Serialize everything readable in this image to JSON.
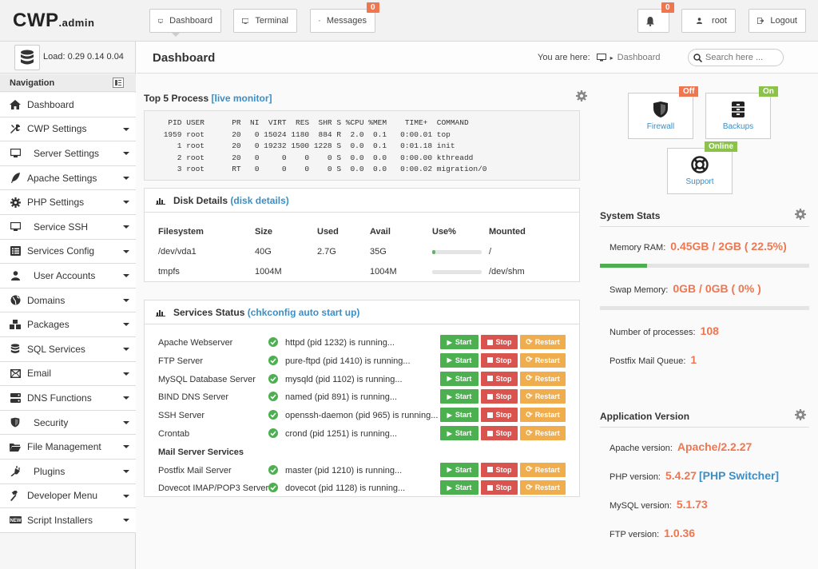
{
  "topbar": {
    "logo_main": "CWP",
    "logo_sub": "admin",
    "dashboard_label": "Dashboard",
    "terminal_label": "Terminal",
    "messages_label": "Messages",
    "messages_count": "0",
    "notifications_count": "0",
    "user_label": "root",
    "logout_label": "Logout"
  },
  "sidebar": {
    "load_label": "Load: 0.29  0.14  0.04",
    "nav_heading": "Navigation",
    "items": [
      {
        "label": "Dashboard",
        "icon": "home-icon"
      },
      {
        "label": "CWP Settings",
        "icon": "tools-icon"
      },
      {
        "label": "Server Settings",
        "icon": "monitor-icon"
      },
      {
        "label": "Apache Settings",
        "icon": "feather-icon"
      },
      {
        "label": "PHP Settings",
        "icon": "gear-icon"
      },
      {
        "label": "Service SSH",
        "icon": "monitor-icon"
      },
      {
        "label": "Services Config",
        "icon": "list-icon"
      },
      {
        "label": "User Accounts",
        "icon": "user-icon"
      },
      {
        "label": "Domains",
        "icon": "globe-icon"
      },
      {
        "label": "Packages",
        "icon": "boxes-icon"
      },
      {
        "label": "SQL Services",
        "icon": "database-icon"
      },
      {
        "label": "Email",
        "icon": "envelope-icon"
      },
      {
        "label": "DNS Functions",
        "icon": "server-icon"
      },
      {
        "label": "Security",
        "icon": "shield-icon"
      },
      {
        "label": "File Management",
        "icon": "folder-icon"
      },
      {
        "label": "Plugins",
        "icon": "plug-icon"
      },
      {
        "label": "Developer Menu",
        "icon": "hammer-icon"
      },
      {
        "label": "Script Installers",
        "icon": "new-icon"
      }
    ]
  },
  "header": {
    "title": "Dashboard",
    "you_are_here": "You are here:",
    "crumb": "Dashboard",
    "search_placeholder": "Search here ..."
  },
  "top_process": {
    "title": "Top 5 Process",
    "link": "[live monitor]",
    "output": "  PID USER      PR  NI  VIRT  RES  SHR S %CPU %MEM    TIME+  COMMAND\n 1959 root      20   0 15024 1180  884 R  2.0  0.1   0:00.01 top\n    1 root      20   0 19232 1500 1228 S  0.0  0.1   0:01.18 init\n    2 root      20   0     0    0    0 S  0.0  0.0   0:00.00 kthreadd\n    3 root      RT   0     0    0    0 S  0.0  0.0   0:00.02 migration/0"
  },
  "disk": {
    "title": "Disk Details",
    "link": "(disk details)",
    "headers": [
      "Filesystem",
      "Size",
      "Used",
      "Avail",
      "Use%",
      "Mounted"
    ],
    "rows": [
      {
        "fs": "/dev/vda1",
        "size": "40G",
        "used": "2.7G",
        "avail": "35G",
        "use_pct": 0.07,
        "mounted": "/"
      },
      {
        "fs": "tmpfs",
        "size": "1004M",
        "used": "",
        "avail": "1004M",
        "use_pct": 0,
        "mounted": "/dev/shm"
      }
    ]
  },
  "services": {
    "title": "Services Status",
    "link": "(chkconfig auto start up)",
    "start_label": "Start",
    "stop_label": "Stop",
    "restart_label": "Restart",
    "mail_heading": "Mail Server Services",
    "rows": [
      {
        "name": "Apache Webserver",
        "status": "httpd (pid 1232) is running..."
      },
      {
        "name": "FTP Server",
        "status": "pure-ftpd (pid 1410) is running..."
      },
      {
        "name": "MySQL Database Server",
        "status": "mysqld (pid 1102) is running..."
      },
      {
        "name": "BIND DNS Server",
        "status": "named (pid 891) is running..."
      },
      {
        "name": "SSH Server",
        "status": "openssh-daemon (pid 965) is running..."
      },
      {
        "name": "Crontab",
        "status": "crond (pid 1251) is running..."
      }
    ],
    "mail_rows": [
      {
        "name": "Postfix Mail Server",
        "status": "master (pid 1210) is running..."
      },
      {
        "name": "Dovecot IMAP/POP3 Server",
        "status": "dovecot (pid 1128) is running..."
      }
    ]
  },
  "quick": {
    "firewall_label": "Firewall",
    "firewall_status": "Off",
    "backups_label": "Backups",
    "backups_status": "On",
    "support_label": "Support",
    "support_status": "Online"
  },
  "system_stats": {
    "title": "System Stats",
    "memory_label": "Memory RAM:",
    "memory_value": "0.45GB / 2GB ( 22.5%)",
    "memory_fraction": 0.225,
    "swap_label": "Swap Memory:",
    "swap_value": "0GB / 0GB ( 0% )",
    "processes_label": "Number of processes:",
    "processes_value": "108",
    "mailq_label": "Postfix Mail Queue:",
    "mailq_value": "1"
  },
  "app_version": {
    "title": "Application Version",
    "apache_label": "Apache version:",
    "apache_value": "Apache/2.2.27",
    "php_label": "PHP version:",
    "php_value": "5.4.27",
    "php_link": "[PHP Switcher]",
    "mysql_label": "MySQL version:",
    "mysql_value": "5.1.73",
    "ftp_label": "FTP version:",
    "ftp_value": "1.0.36"
  },
  "colors": {
    "accent_orange": "#ee7751",
    "link_blue": "#3a8fc7",
    "start_green": "#4caf50",
    "stop_red": "#d9534f",
    "restart_orange": "#f0ad4e"
  }
}
